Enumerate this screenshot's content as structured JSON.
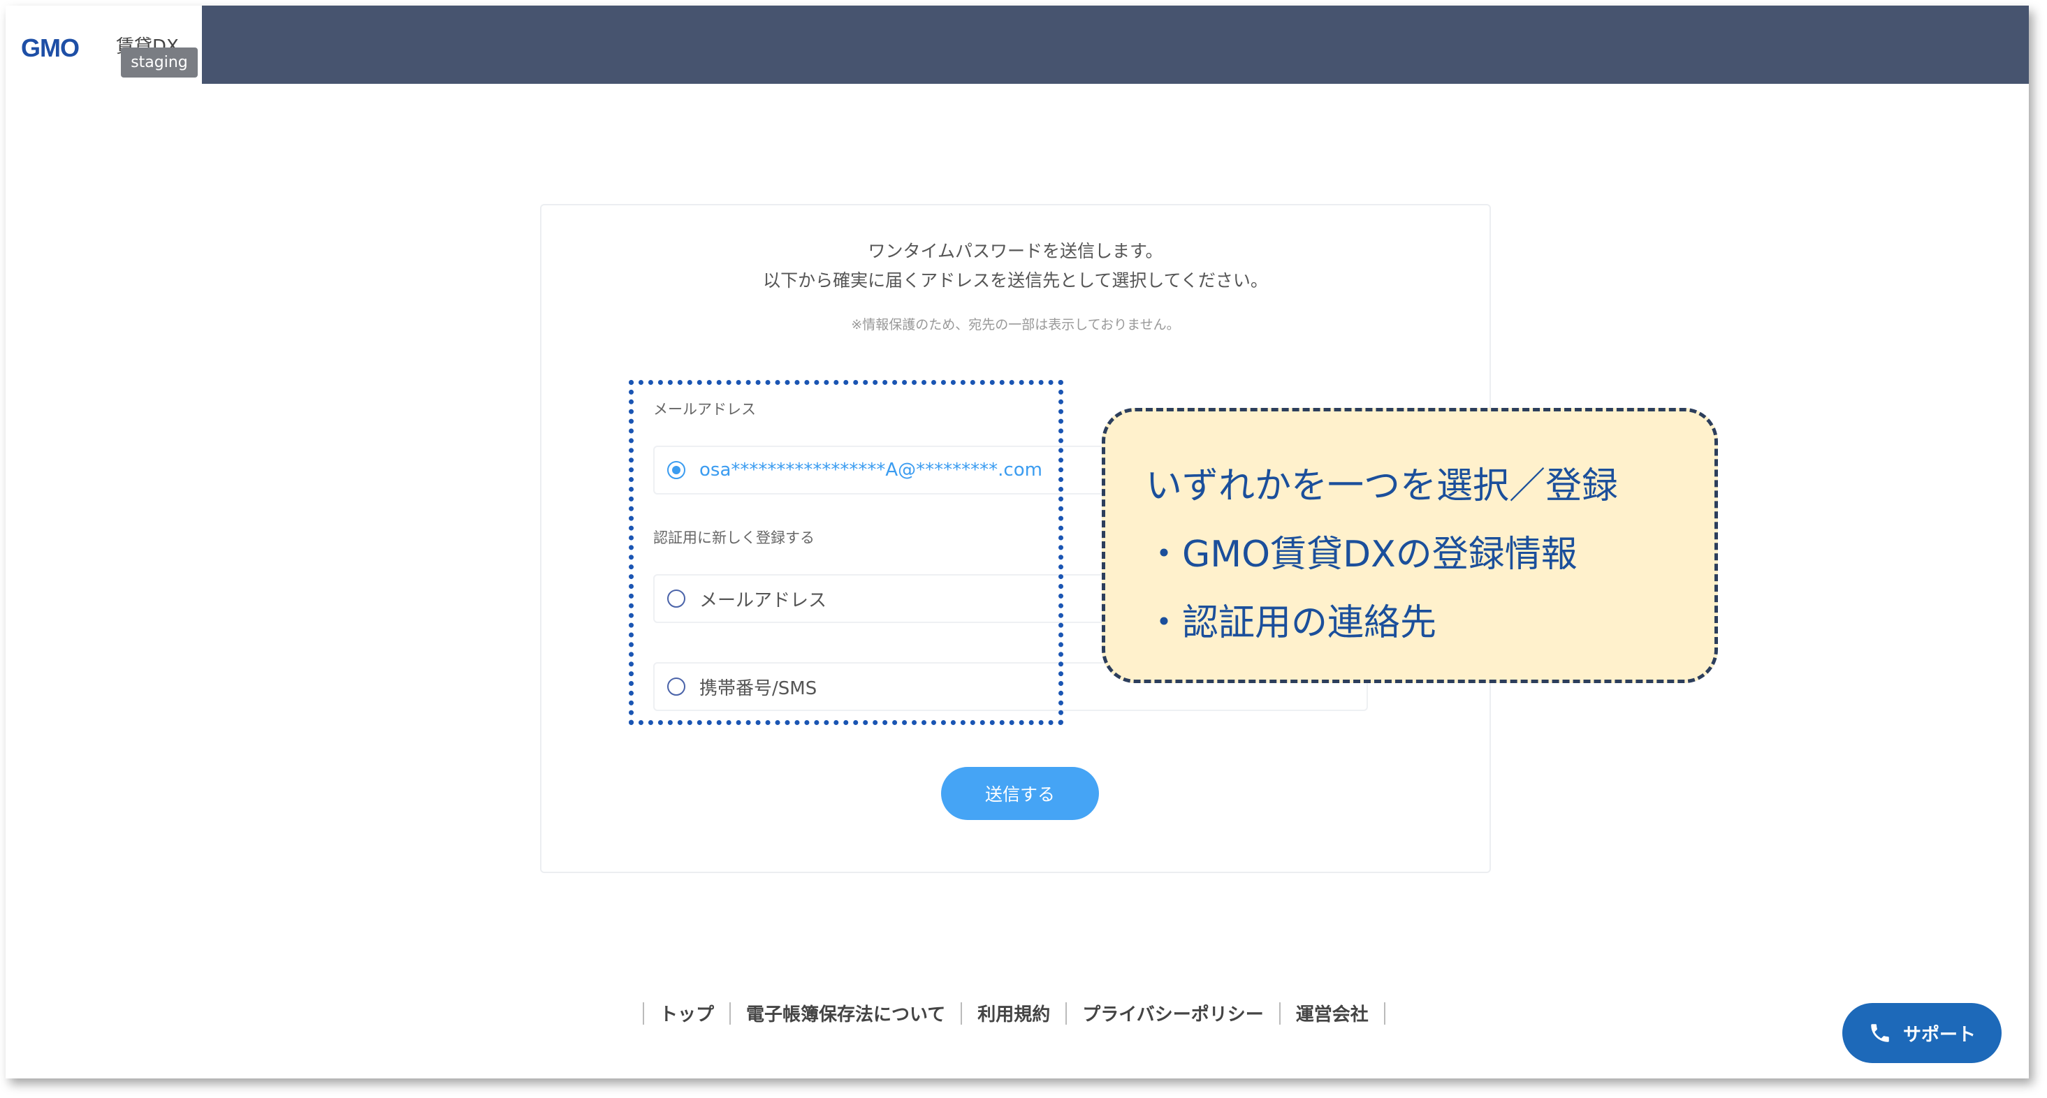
{
  "header": {
    "logo_text": "GMO",
    "logo_sub": "賃貸DX",
    "env_badge": "staging"
  },
  "card": {
    "title_line1": "ワンタイムパスワードを送信します。",
    "title_line2": "以下から確実に届くアドレスを送信先として選択してください。",
    "note": "※情報保護のため、宛先の一部は表示しておりません。",
    "registered_section_label": "メールアドレス",
    "registered_email": "osa*****************A@*********.com",
    "new_section_label": "認証用に新しく登録する",
    "option_email": "メールアドレス",
    "option_sms": "携帯番号/SMS",
    "send_button": "送信する"
  },
  "callout": {
    "line1": "いずれかを一つを選択／登録",
    "line2": "・GMO賃貸DXの登録情報",
    "line3": "・認証用の連絡先"
  },
  "footer": {
    "links": [
      "トップ",
      "電子帳簿保存法について",
      "利用規約",
      "プライバシーポリシー",
      "運営会社"
    ]
  },
  "support": {
    "label": "サポート"
  },
  "colors": {
    "topbar": "#47546f",
    "accent": "#45a4f5",
    "support": "#1d69b9",
    "callout_bg": "#fff1cc",
    "highlight": "#1a55b3"
  }
}
